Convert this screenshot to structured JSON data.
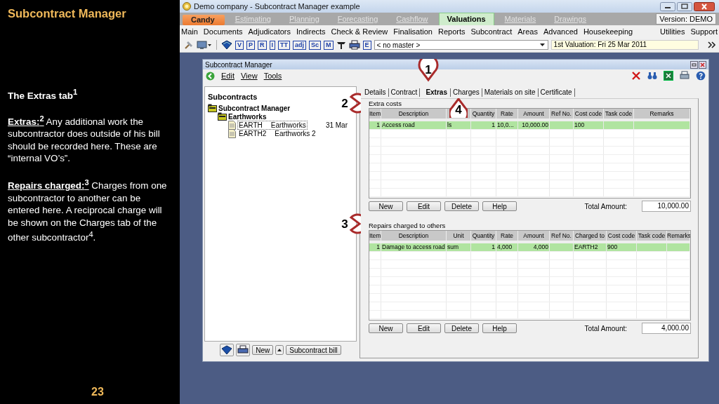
{
  "slide": {
    "title": "Subcontract Manager",
    "heading": "The Extras tab$^{1}$",
    "paragraphs": [
      "**Extras:$^{2}$**  Any additional work the subcontractor does outside of his bill should be recorded here.  These are “internal VO’s”.",
      "**Repairs charged:$^{3}$**  Charges from  one subcontractor to another can be entered here.  A reciprocal charge will be shown on the Charges tab of the other subcontractor$^{4}$."
    ],
    "page_number": "23"
  },
  "app": {
    "title": "Demo company - Subcontract Manager example",
    "product_tab": "Candy",
    "tabs": [
      {
        "label": "Estimating",
        "selected": false
      },
      {
        "label": "Planning",
        "selected": false
      },
      {
        "label": "Forecasting",
        "selected": false
      },
      {
        "label": "Cashflow",
        "selected": false
      },
      {
        "label": "Valuations",
        "selected": true
      },
      {
        "label": "Materials",
        "selected": false
      },
      {
        "label": "Drawings",
        "selected": false
      }
    ],
    "version": "Version: DEMO",
    "menu": [
      "Main",
      "Documents",
      "Adjudicators",
      "Indirects",
      "Check & Review",
      "Finalisation",
      "Reports",
      "Subcontract",
      "Areas",
      "Advanced",
      "Housekeeping"
    ],
    "menu_right": [
      "Utilities",
      "Support"
    ],
    "toolbar_letters": [
      "V",
      "P",
      "R",
      "I",
      "TT",
      "adj",
      "Sc",
      "M"
    ],
    "toolbar_letter_last": "E",
    "master": "< no master >",
    "valuation": "1st Valuation: Fri 25 Mar 2011"
  },
  "child": {
    "title": "Subcontract Manager",
    "menu": [
      "Edit",
      "View",
      "Tools"
    ],
    "tree": {
      "heading": "Subcontracts",
      "items": [
        {
          "label": "Subcontract Manager",
          "children": [
            {
              "label": "Earthworks",
              "children": [
                {
                  "code": "EARTH",
                  "label": "Earthworks",
                  "date": "31 Mar",
                  "selected": true
                },
                {
                  "code": "EARTH2",
                  "label": "Earthworks 2",
                  "selected": false
                }
              ]
            }
          ]
        }
      ]
    },
    "bottom_buttons": [
      "New",
      "Subcontract bill"
    ],
    "tabs": [
      {
        "label": "Details",
        "selected": false
      },
      {
        "label": "Contract",
        "selected": false
      },
      {
        "label": "Extras",
        "selected": true
      },
      {
        "label": "Charges",
        "selected": false
      },
      {
        "label": "Materials on site",
        "selected": false
      },
      {
        "label": "Certificate",
        "selected": false
      }
    ],
    "sections": [
      {
        "title": "Extra costs",
        "columns": [
          {
            "label": "Item"
          },
          {
            "label": "Description"
          },
          {},
          {
            "label": "Quantity"
          },
          {
            "label": "Rate"
          },
          {
            "label": "Amount"
          },
          {
            "label": "Ref No."
          },
          {
            "label": "Cost code"
          },
          {
            "label": "Task code"
          },
          {
            "label": "Remarks"
          }
        ],
        "rows": [
          {
            "cells": [
              "1",
              "Access road",
              "ls",
              "1",
              "10,0...",
              "10,000.00",
              "",
              "100",
              "",
              ""
            ],
            "selected": true
          }
        ],
        "buttons": [
          "New",
          "Edit",
          "Delete",
          "Help"
        ],
        "total_label": "Total Amount:",
        "total": "10,000.00"
      },
      {
        "title": "Repairs charged to others",
        "columns": [
          {
            "label": "Item"
          },
          {
            "label": "Description"
          },
          {
            "label": "Unit"
          },
          {
            "label": "Quantity"
          },
          {
            "label": "Rate"
          },
          {
            "label": "Amount"
          },
          {
            "label": "Ref No."
          },
          {
            "label": "Charged to"
          },
          {
            "label": "Cost code"
          },
          {
            "label": "Task code"
          },
          {
            "label": "Remarks"
          }
        ],
        "rows": [
          {
            "cells": [
              "1",
              "Damage to access road",
              "sum",
              "1",
              "4,000",
              "4,000",
              "",
              "EARTH2",
              "900",
              "",
              ""
            ],
            "selected": true
          }
        ],
        "buttons": [
          "New",
          "Edit",
          "Delete",
          "Help"
        ],
        "total_label": "Total Amount:",
        "total": "4,000.00"
      }
    ]
  },
  "callouts": [
    "1",
    "2",
    "3",
    "4"
  ]
}
